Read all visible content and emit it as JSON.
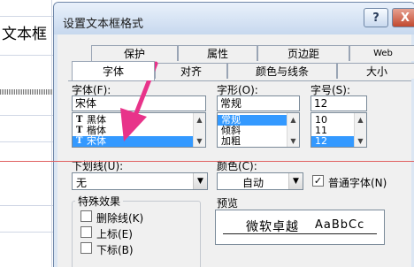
{
  "background": {
    "cell_text": "文本框"
  },
  "dialog": {
    "title": "设置文本框格式",
    "help_label": "?",
    "close_label": "X",
    "tabs_back": [
      "保护",
      "属性",
      "页边距",
      "Web"
    ],
    "tabs_front": [
      "字体",
      "对齐",
      "颜色与线条",
      "大小"
    ],
    "active_tab": "字体"
  },
  "font": {
    "label": "字体(F):",
    "value": "宋体",
    "items": [
      {
        "label": "黑体",
        "icon": "truetype-icon",
        "selected": false
      },
      {
        "label": "楷体",
        "icon": "truetype-icon",
        "selected": false
      },
      {
        "label": "宋体",
        "icon": "truetype-icon",
        "selected": true
      }
    ]
  },
  "style": {
    "label": "字形(O):",
    "value": "常规",
    "items": [
      {
        "label": "常规",
        "selected": true
      },
      {
        "label": "倾斜",
        "selected": false
      },
      {
        "label": "加粗",
        "selected": false
      }
    ]
  },
  "size": {
    "label": "字号(S):",
    "value": "12",
    "items": [
      {
        "label": "10",
        "selected": false
      },
      {
        "label": "11",
        "selected": false
      },
      {
        "label": "12",
        "selected": true
      }
    ]
  },
  "underline": {
    "label": "下划线(U):",
    "value": "无"
  },
  "color": {
    "label": "颜色(C):",
    "value": "自动"
  },
  "normal_font": {
    "label": "普通字体(N)",
    "checked": true
  },
  "effects": {
    "title": "特殊效果",
    "items": [
      {
        "label": "删除线(K)",
        "checked": false
      },
      {
        "label": "上标(E)",
        "checked": false
      },
      {
        "label": "下标(B)",
        "checked": false
      }
    ]
  },
  "preview": {
    "title": "预览",
    "text_cn": "微软卓越",
    "text_en": "AaBbCc"
  },
  "colors": {
    "arrow": "#e8338a",
    "annotation_line": "#e06060",
    "selection": "#3399ff"
  }
}
